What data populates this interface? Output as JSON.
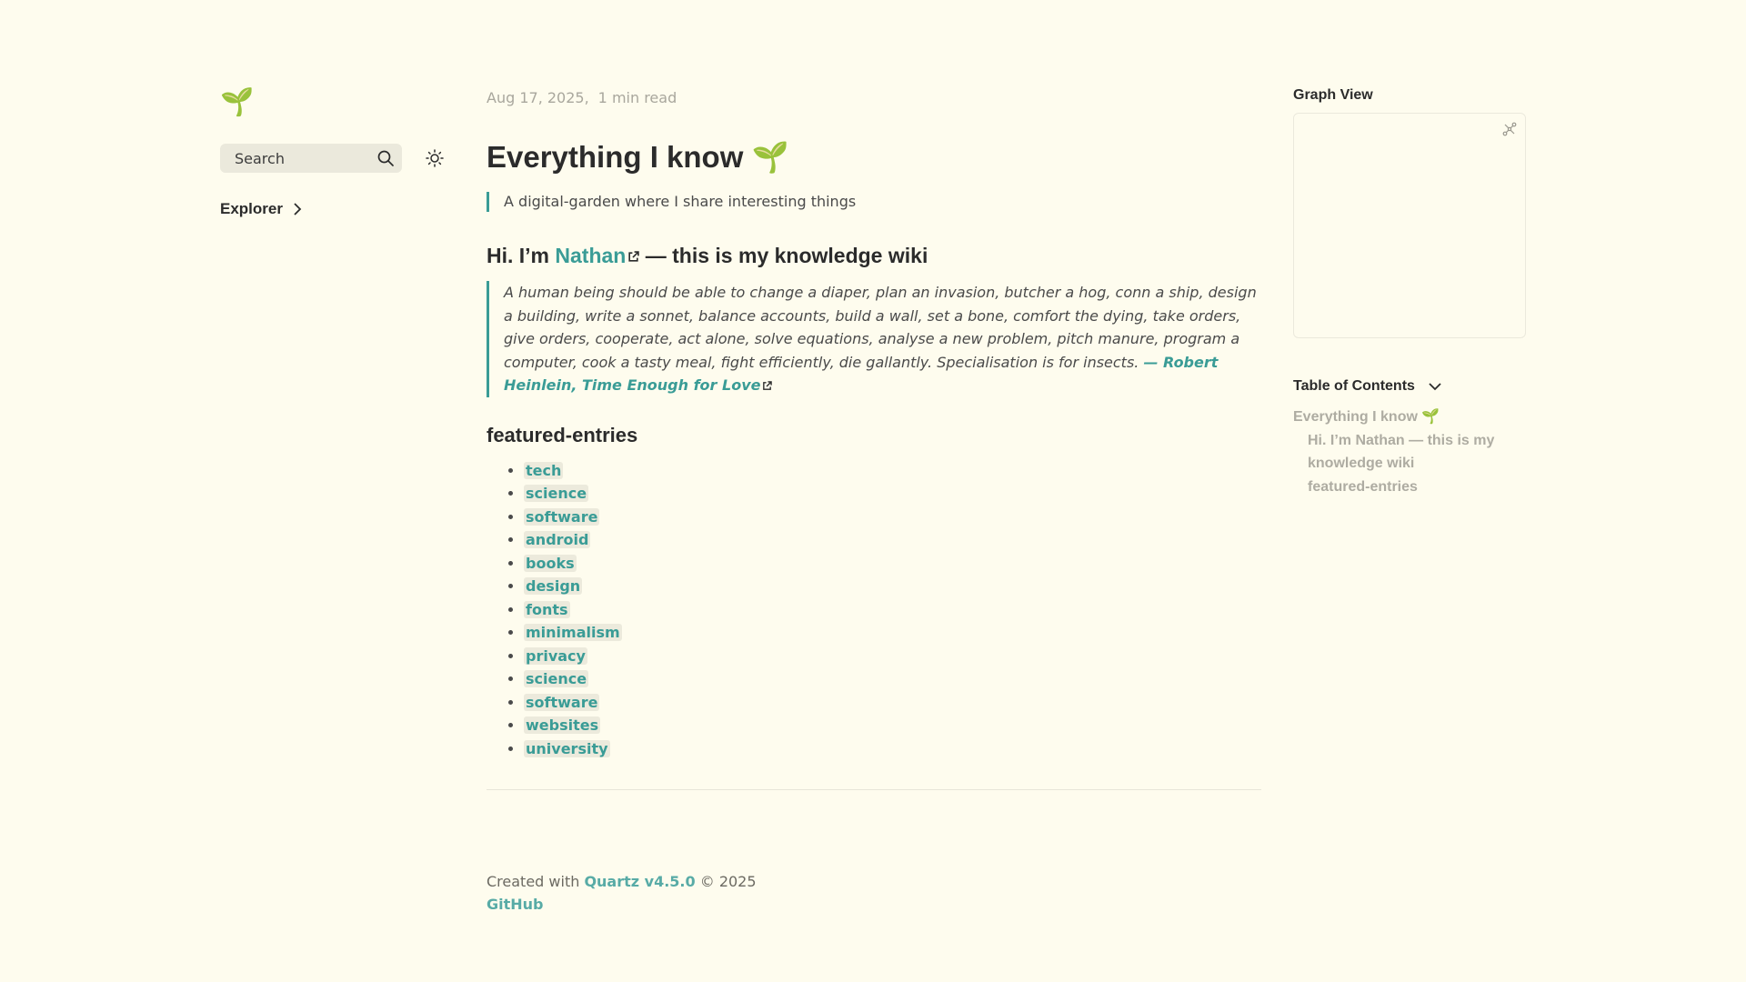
{
  "logo": "🌱",
  "search": {
    "placeholder": "Search"
  },
  "explorer": {
    "label": "Explorer"
  },
  "meta": {
    "date": "Aug 17, 2025,",
    "read_time": "1 min read"
  },
  "title": "Everything I know 🌱",
  "description": "A digital-garden where I share interesting things",
  "intro": {
    "prefix": "Hi. I’m ",
    "name_link": "Nathan",
    "suffix": " — this is my knowledge wiki"
  },
  "quote": {
    "text": "A human being should be able to change a diaper, plan an invasion, butcher a hog, conn a ship, design a building, write a sonnet, balance accounts, build a wall, set a bone, comfort the dying, take orders, give orders, cooperate, act alone, solve equations, analyse a new problem, pitch manure, program a computer, cook a tasty meal, fight efficiently, die gallantly. Specialisation is for insects. ",
    "attribution": "— Robert Heinlein, Time Enough for Love"
  },
  "featured": {
    "heading": "featured-entries",
    "items": [
      "tech",
      "science",
      "software",
      "android",
      "books",
      "design",
      "fonts",
      "minimalism",
      "privacy",
      "science",
      "software",
      "websites",
      "university"
    ]
  },
  "footer": {
    "created_with": "Created with ",
    "quartz_link": "Quartz v4.5.0",
    "copyright": " © 2025",
    "github_link": "GitHub"
  },
  "graph": {
    "title": "Graph View"
  },
  "toc": {
    "title": "Table of Contents",
    "items": [
      "Everything I know 🌱",
      "Hi. I’m Nathan — this is my knowledge wiki",
      "featured-entries"
    ]
  },
  "colors": {
    "background": "#fefcee",
    "accent": "#3a9c96",
    "muted": "#aeaca2"
  },
  "icons": [
    "seedling-logo",
    "search-icon",
    "sun-icon",
    "chevron-right-icon",
    "external-link-icon",
    "expand-graph-icon",
    "chevron-down-icon"
  ]
}
